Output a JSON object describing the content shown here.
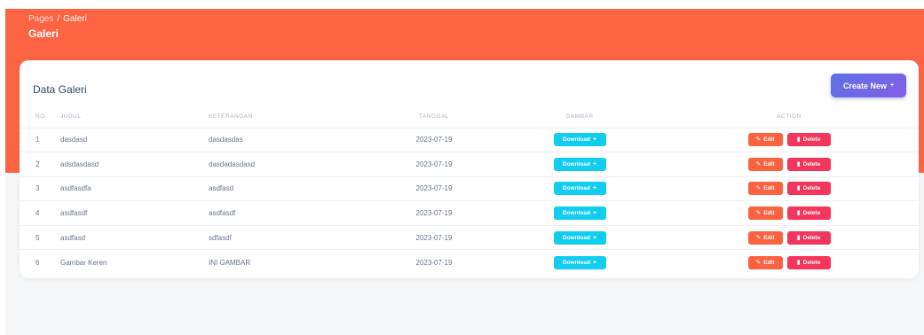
{
  "breadcrumb": {
    "root": "Pages",
    "separator": "/",
    "current": "Galeri"
  },
  "page_title": "Galeri",
  "card": {
    "title": "Data Galeri",
    "create_button": {
      "label": "Create New",
      "icon": "+"
    }
  },
  "table": {
    "headers": [
      "NO",
      "JUDUL",
      "KETERANGAN",
      "TANGGAL",
      "GAMBAR",
      "ACTION"
    ],
    "download_label": "Download",
    "download_icon": "+",
    "edit_label": "Edit",
    "delete_label": "Delete",
    "rows": [
      {
        "no": "1",
        "judul": "dasdasd",
        "keterangan": "dasdasdas",
        "tanggal": "2023-07-19"
      },
      {
        "no": "2",
        "judul": "adsdasdasd",
        "keterangan": "dasdadasdasd",
        "tanggal": "2023-07-19"
      },
      {
        "no": "3",
        "judul": "asdfasdfa",
        "keterangan": "asdfasd",
        "tanggal": "2023-07-19"
      },
      {
        "no": "4",
        "judul": "asdfasdf",
        "keterangan": "asdfasdf",
        "tanggal": "2023-07-19"
      },
      {
        "no": "5",
        "judul": "asdfasd",
        "keterangan": "sdfasdf",
        "tanggal": "2023-07-19"
      },
      {
        "no": "6",
        "judul": "Gambar Keren",
        "keterangan": "INI GAMBAR",
        "tanggal": "2023-07-19"
      }
    ]
  },
  "colors": {
    "header": "#fd6443",
    "primary": "#5e72e4",
    "info": "#11cdef",
    "warning": "#fb6340",
    "danger": "#f5365c"
  }
}
